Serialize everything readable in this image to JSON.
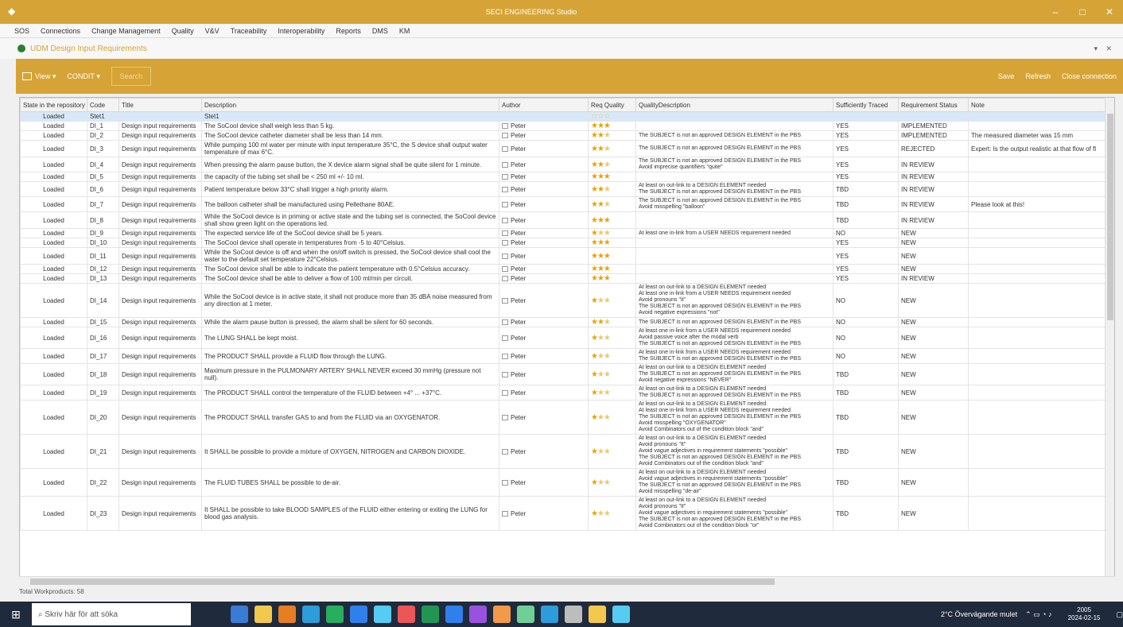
{
  "window": {
    "title": "SECI ENGINEERING Studio"
  },
  "menu": [
    "SOS",
    "Connections",
    "Change Management",
    "Quality",
    "V&V",
    "Traceability",
    "Interoperability",
    "Reports",
    "DMS",
    "KM"
  ],
  "panel": {
    "title": "UDM Design Input Requirements"
  },
  "toolbar": {
    "view_label": "View",
    "filter_label": "CONDIT",
    "search_label": "Search",
    "save_label": "Save",
    "refresh_label": "Refresh",
    "close_label": "Close connection"
  },
  "columns": [
    "State in the repository",
    "Code",
    "Title",
    "Description",
    "Author",
    "Req Quality",
    "QualityDescription",
    "Sufficiently Traced",
    "Requirement Status",
    "Note"
  ],
  "filter_row": {
    "state": "Loaded",
    "code": "Stet1",
    "desc": "Stet1"
  },
  "rows": [
    {
      "state": "Loaded",
      "code": "DI_1",
      "title": "Design input requirements",
      "desc": "The SoCool device shall weigh less than 5 kg.",
      "author": "Peter",
      "stars": 3,
      "qd": "",
      "traced": "YES",
      "status": "IMPLEMENTED",
      "note": ""
    },
    {
      "state": "Loaded",
      "code": "DI_2",
      "title": "Design input requirements",
      "desc": "The SoCool device catheter diameter shall be less than 14 mm.",
      "author": "Peter",
      "stars": 2,
      "qd": "The SUBJECT is not an approved DESIGN ELEMENT in the PBS",
      "traced": "YES",
      "status": "IMPLEMENTED",
      "note": "The measured diameter was 15 mm"
    },
    {
      "state": "Loaded",
      "code": "DI_3",
      "title": "Design input requirements",
      "desc": "While pumping 100 ml water per minute with input temperature 35°C, the S device shall output water temperature of max 6°C.",
      "author": "Peter",
      "stars": 2,
      "qd": "The SUBJECT is not an approved DESIGN ELEMENT in the PBS",
      "traced": "YES",
      "status": "REJECTED",
      "note": "Expert: Is the output realistic at that flow of fl"
    },
    {
      "state": "Loaded",
      "code": "DI_4",
      "title": "Design input requirements",
      "desc": "When pressing the alarm pause button, the X device alarm signal shall be quite silent for 1 minute.",
      "author": "Peter",
      "stars": 2,
      "qd": "The SUBJECT is not an approved DESIGN ELEMENT in the PBS\nAvoid imprecise quantifiers \"quite\"",
      "traced": "YES",
      "status": "IN REVIEW",
      "note": ""
    },
    {
      "state": "Loaded",
      "code": "DI_5",
      "title": "Design input requirements",
      "desc": "the capacity of the tubing set shall be < 250 ml +/- 10 ml.",
      "author": "Peter",
      "stars": 3,
      "qd": "",
      "traced": "YES",
      "status": "IN REVIEW",
      "note": ""
    },
    {
      "state": "Loaded",
      "code": "DI_6",
      "title": "Design input requirements",
      "desc": "Patient temperature below 33°C shall trigger a high priority alarm.",
      "author": "Peter",
      "stars": 2,
      "qd": "At least on out-link to a DESIGN ELEMENT needed\nThe SUBJECT is not an approved DESIGN ELEMENT in the PBS",
      "traced": "TBD",
      "status": "IN REVIEW",
      "note": ""
    },
    {
      "state": "Loaded",
      "code": "DI_7",
      "title": "Design input requirements",
      "desc": "The balloon catheter shall be manufactured using Pellethane 80AE.",
      "author": "Peter",
      "stars": 2,
      "qd": "The SUBJECT is not an approved DESIGN ELEMENT in the PBS\nAvoid misspelling \"balloon\"",
      "traced": "TBD",
      "status": "IN REVIEW",
      "note": "Please look at this!"
    },
    {
      "state": "Loaded",
      "code": "DI_8",
      "title": "Design input requirements",
      "desc": "While the SoCool device is in priming or active state and the tubing set is connected, the SoCool device shall show green light on the operations led.",
      "author": "Peter",
      "stars": 3,
      "qd": "",
      "traced": "TBD",
      "status": "IN REVIEW",
      "note": ""
    },
    {
      "state": "Loaded",
      "code": "DI_9",
      "title": "Design input requirements",
      "desc": "The expected service life of the SoCool device shall be 5 years.",
      "author": "Peter",
      "stars": 1,
      "qd": "At least one in-link from a USER NEEDS requirement needed",
      "traced": "NO",
      "status": "NEW",
      "note": ""
    },
    {
      "state": "Loaded",
      "code": "DI_10",
      "title": "Design input requirements",
      "desc": "The SoCool device shall operate in temperatures from -5 to 40°Celsius.",
      "author": "Peter",
      "stars": 3,
      "qd": "",
      "traced": "YES",
      "status": "NEW",
      "note": ""
    },
    {
      "state": "Loaded",
      "code": "DI_11",
      "title": "Design input requirements",
      "desc": "While the SoCool device is off and when the on/off switch is pressed, the SoCool device shall cool the water to the default set temperature 22°Celsius.",
      "author": "Peter",
      "stars": 3,
      "qd": "",
      "traced": "YES",
      "status": "NEW",
      "note": ""
    },
    {
      "state": "Loaded",
      "code": "DI_12",
      "title": "Design input requirements",
      "desc": "The SoCool device shall be able to indicate the patient temperature with 0.5°Celsius accuracy.",
      "author": "Peter",
      "stars": 3,
      "qd": "",
      "traced": "YES",
      "status": "NEW",
      "note": ""
    },
    {
      "state": "Loaded",
      "code": "DI_13",
      "title": "Design input requirements",
      "desc": "The SoCool device shall be able to deliver a flow of 100 ml/min per circuit.",
      "author": "Peter",
      "stars": 3,
      "qd": "",
      "traced": "YES",
      "status": "IN REVIEW",
      "note": ""
    },
    {
      "state": "Loaded",
      "code": "DI_14",
      "title": "Design input requirements",
      "desc": "While the SoCool device is in active state, it shall not produce more than 35 dBA noise measured from any direction at 1 meter.",
      "author": "Peter",
      "stars": 1,
      "qd": "At least on out-link to a DESIGN ELEMENT needed\nAt least one in-link from a USER NEEDS requirement needed\nAvoid pronouns \"it\"\nThe SUBJECT is not an approved DESIGN ELEMENT in the PBS\nAvoid negative expressions \"not\"",
      "traced": "NO",
      "status": "NEW",
      "note": ""
    },
    {
      "state": "Loaded",
      "code": "DI_15",
      "title": "Design input requirements",
      "desc": "While the alarm pause button is pressed, the alarm shall be silent for 60 seconds.",
      "author": "Peter",
      "stars": 2,
      "qd": "The SUBJECT is not an approved DESIGN ELEMENT in the PBS",
      "traced": "NO",
      "status": "NEW",
      "note": ""
    },
    {
      "state": "Loaded",
      "code": "DI_16",
      "title": "Design input requirements",
      "desc": "The LUNG SHALL be kept moist.",
      "author": "Peter",
      "stars": 1,
      "qd": "At least one in-link from a USER NEEDS requirement needed\nAvoid passive voice after the modal verb\nThe SUBJECT is not an approved DESIGN ELEMENT in the PBS",
      "traced": "NO",
      "status": "NEW",
      "note": ""
    },
    {
      "state": "Loaded",
      "code": "DI_17",
      "title": "Design input requirements",
      "desc": "The PRODUCT SHALL provide a FLUID flow through the LUNG.",
      "author": "Peter",
      "stars": 1,
      "qd": "At least one in-link from a USER NEEDS requirement needed\nThe SUBJECT is not an approved DESIGN ELEMENT in the PBS",
      "traced": "NO",
      "status": "NEW",
      "note": ""
    },
    {
      "state": "Loaded",
      "code": "DI_18",
      "title": "Design input requirements",
      "desc": "Maximum pressure in the PULMONARY ARTERY SHALL NEVER exceed 30 mmHg (pressure not null).",
      "author": "Peter",
      "stars": 1,
      "qd": "At least on out-link to a DESIGN ELEMENT needed\nThe SUBJECT is not an approved DESIGN ELEMENT in the PBS\nAvoid negative expressions \"NEVER\"",
      "traced": "TBD",
      "status": "NEW",
      "note": ""
    },
    {
      "state": "Loaded",
      "code": "DI_19",
      "title": "Design input requirements",
      "desc": "The PRODUCT SHALL control the temperature of the FLUID between +4° ... +37°C.",
      "author": "Peter",
      "stars": 1,
      "qd": "At least on out-link to a DESIGN ELEMENT needed\nThe SUBJECT is not an approved DESIGN ELEMENT in the PBS",
      "traced": "TBD",
      "status": "NEW",
      "note": ""
    },
    {
      "state": "Loaded",
      "code": "DI_20",
      "title": "Design input requirements",
      "desc": "The PRODUCT SHALL transfer GAS to and from the FLUID via an OXYGENATOR.",
      "author": "Peter",
      "stars": 1,
      "qd": "At least on out-link to a DESIGN ELEMENT needed\nAt least one in-link from a USER NEEDS requirement needed\nThe SUBJECT is not an approved DESIGN ELEMENT in the PBS\nAvoid misspelling \"OXYGENATOR\"\nAvoid Combinators out of the condition block \"and\"",
      "traced": "TBD",
      "status": "NEW",
      "note": ""
    },
    {
      "state": "Loaded",
      "code": "DI_21",
      "title": "Design input requirements",
      "desc": "It SHALL be possible to provide a mixture of OXYGEN, NITROGEN and CARBON DIOXIDE.",
      "author": "Peter",
      "stars": 1,
      "qd": "At least on out-link to a DESIGN ELEMENT needed\nAvoid pronouns \"It\"\nAvoid vague adjectives in requirement statements \"possible\"\nThe SUBJECT is not an approved DESIGN ELEMENT in the PBS\nAvoid Combinators out of the condition block \"and\"",
      "traced": "TBD",
      "status": "NEW",
      "note": ""
    },
    {
      "state": "Loaded",
      "code": "DI_22",
      "title": "Design input requirements",
      "desc": "The FLUID TUBES SHALL be possible to de-air.",
      "author": "Peter",
      "stars": 1,
      "qd": "At least on out-link to a DESIGN ELEMENT needed\nAvoid vague adjectives in requirement statements \"possible\"\nThe SUBJECT is not an approved DESIGN ELEMENT in the PBS\nAvoid misspelling \"de-air\"",
      "traced": "TBD",
      "status": "NEW",
      "note": ""
    },
    {
      "state": "Loaded",
      "code": "DI_23",
      "title": "Design input requirements",
      "desc": "It SHALL be possible to take BLOOD SAMPLES of the FLUID either entering or exiting the LUNG for blood gas analysis.",
      "author": "Peter",
      "stars": 1,
      "qd": "At least on out-link to a DESIGN ELEMENT needed\nAvoid pronouns \"It\"\nAvoid vague adjectives in requirement statements \"possible\"\nThe SUBJECT is not an approved DESIGN ELEMENT in the PBS\nAvoid Combinators out of the condition block \"or\"",
      "traced": "TBD",
      "status": "NEW",
      "note": ""
    }
  ],
  "status_bar": "Total Workproducts: 58",
  "taskbar": {
    "search_placeholder": "Skriv här för att söka",
    "weather": "2°C Övervägande mulet",
    "time": "2005",
    "date": "2024-02-15"
  },
  "colors": {
    "accent": "#d6a436",
    "star": "#e8a200"
  }
}
